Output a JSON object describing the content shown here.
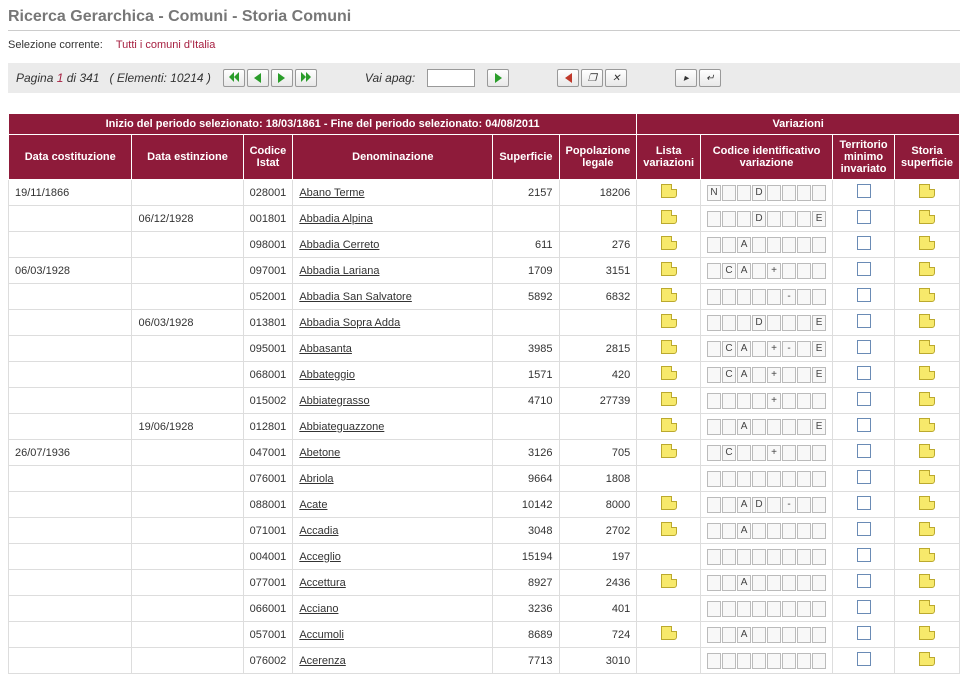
{
  "page_title": "Ricerca Gerarchica - Comuni - Storia Comuni",
  "selection_label": "Selezione corrente:",
  "selection_value": "Tutti i comuni d'Italia",
  "pager": {
    "prefix": "Pagina",
    "current": "1",
    "of": "di",
    "total_pages": "341",
    "elements_label": "( Elementi:",
    "elements": "10214",
    "elements_suffix": ")",
    "goto_label": "Vai apag:",
    "goto_value": ""
  },
  "headers": {
    "period_banner": "Inizio del periodo selezionato: 18/03/1861 - Fine del periodo selezionato: 04/08/2011",
    "variazioni": "Variazioni",
    "data_cost": "Data costituzione",
    "data_est": "Data estinzione",
    "codice_istat": "Codice Istat",
    "denom": "Denominazione",
    "superficie": "Superficie",
    "pop": "Popolazione legale",
    "lista_var": "Lista variazioni",
    "cod_ident": "Codice identificativo variazione",
    "territ": "Territorio minimo invariato",
    "storia_sup": "Storia superficie"
  },
  "rows": [
    {
      "cost": "19/11/1866",
      "est": "",
      "istat": "028001",
      "denom": "Abano Terme",
      "sup": "2157",
      "pop": "18206",
      "lista": true,
      "codes": [
        "N",
        "",
        "",
        "D",
        "",
        "",
        "",
        ""
      ],
      "storia": true
    },
    {
      "cost": "",
      "est": "06/12/1928",
      "istat": "001801",
      "denom": "Abbadia Alpina",
      "sup": "",
      "pop": "",
      "lista": true,
      "codes": [
        "",
        "",
        "",
        "D",
        "",
        "",
        "",
        "E"
      ],
      "storia": true
    },
    {
      "cost": "",
      "est": "",
      "istat": "098001",
      "denom": "Abbadia Cerreto",
      "sup": "611",
      "pop": "276",
      "lista": true,
      "codes": [
        "",
        "",
        "A",
        "",
        "",
        "",
        "",
        ""
      ],
      "storia": true
    },
    {
      "cost": "06/03/1928",
      "est": "",
      "istat": "097001",
      "denom": "Abbadia Lariana",
      "sup": "1709",
      "pop": "3151",
      "lista": true,
      "codes": [
        "",
        "C",
        "A",
        "",
        "+",
        "",
        "",
        ""
      ],
      "storia": true
    },
    {
      "cost": "",
      "est": "",
      "istat": "052001",
      "denom": "Abbadia San Salvatore",
      "sup": "5892",
      "pop": "6832",
      "lista": true,
      "codes": [
        "",
        "",
        "",
        "",
        "",
        "-",
        "",
        ""
      ],
      "storia": true
    },
    {
      "cost": "",
      "est": "06/03/1928",
      "istat": "013801",
      "denom": "Abbadia Sopra Adda",
      "sup": "",
      "pop": "",
      "lista": true,
      "codes": [
        "",
        "",
        "",
        "D",
        "",
        "",
        "",
        "E"
      ],
      "storia": true
    },
    {
      "cost": "",
      "est": "",
      "istat": "095001",
      "denom": "Abbasanta",
      "sup": "3985",
      "pop": "2815",
      "lista": true,
      "codes": [
        "",
        "C",
        "A",
        "",
        "+",
        "-",
        "",
        "E"
      ],
      "storia": true
    },
    {
      "cost": "",
      "est": "",
      "istat": "068001",
      "denom": "Abbateggio",
      "sup": "1571",
      "pop": "420",
      "lista": true,
      "codes": [
        "",
        "C",
        "A",
        "",
        "+",
        "",
        "",
        "E"
      ],
      "storia": true
    },
    {
      "cost": "",
      "est": "",
      "istat": "015002",
      "denom": "Abbiategrasso",
      "sup": "4710",
      "pop": "27739",
      "lista": true,
      "codes": [
        "",
        "",
        "",
        "",
        "+",
        "",
        "",
        ""
      ],
      "storia": true
    },
    {
      "cost": "",
      "est": "19/06/1928",
      "istat": "012801",
      "denom": "Abbiateguazzone",
      "sup": "",
      "pop": "",
      "lista": true,
      "codes": [
        "",
        "",
        "A",
        "",
        "",
        "",
        "",
        "E"
      ],
      "storia": true
    },
    {
      "cost": "26/07/1936",
      "est": "",
      "istat": "047001",
      "denom": "Abetone",
      "sup": "3126",
      "pop": "705",
      "lista": true,
      "codes": [
        "",
        "C",
        "",
        "",
        "+",
        "",
        "",
        ""
      ],
      "storia": true
    },
    {
      "cost": "",
      "est": "",
      "istat": "076001",
      "denom": "Abriola",
      "sup": "9664",
      "pop": "1808",
      "lista": false,
      "codes": [
        "",
        "",
        "",
        "",
        "",
        "",
        "",
        ""
      ],
      "storia": true
    },
    {
      "cost": "",
      "est": "",
      "istat": "088001",
      "denom": "Acate",
      "sup": "10142",
      "pop": "8000",
      "lista": true,
      "codes": [
        "",
        "",
        "A",
        "D",
        "",
        "-",
        "",
        ""
      ],
      "storia": true
    },
    {
      "cost": "",
      "est": "",
      "istat": "071001",
      "denom": "Accadia",
      "sup": "3048",
      "pop": "2702",
      "lista": true,
      "codes": [
        "",
        "",
        "A",
        "",
        "",
        "",
        "",
        ""
      ],
      "storia": true
    },
    {
      "cost": "",
      "est": "",
      "istat": "004001",
      "denom": "Acceglio",
      "sup": "15194",
      "pop": "197",
      "lista": false,
      "codes": [
        "",
        "",
        "",
        "",
        "",
        "",
        "",
        ""
      ],
      "storia": true
    },
    {
      "cost": "",
      "est": "",
      "istat": "077001",
      "denom": "Accettura",
      "sup": "8927",
      "pop": "2436",
      "lista": true,
      "codes": [
        "",
        "",
        "A",
        "",
        "",
        "",
        "",
        ""
      ],
      "storia": true
    },
    {
      "cost": "",
      "est": "",
      "istat": "066001",
      "denom": "Acciano",
      "sup": "3236",
      "pop": "401",
      "lista": false,
      "codes": [
        "",
        "",
        "",
        "",
        "",
        "",
        "",
        ""
      ],
      "storia": true
    },
    {
      "cost": "",
      "est": "",
      "istat": "057001",
      "denom": "Accumoli",
      "sup": "8689",
      "pop": "724",
      "lista": true,
      "codes": [
        "",
        "",
        "A",
        "",
        "",
        "",
        "",
        ""
      ],
      "storia": true
    },
    {
      "cost": "",
      "est": "",
      "istat": "076002",
      "denom": "Acerenza",
      "sup": "7713",
      "pop": "3010",
      "lista": false,
      "codes": [
        "",
        "",
        "",
        "",
        "",
        "",
        "",
        ""
      ],
      "storia": true
    }
  ]
}
